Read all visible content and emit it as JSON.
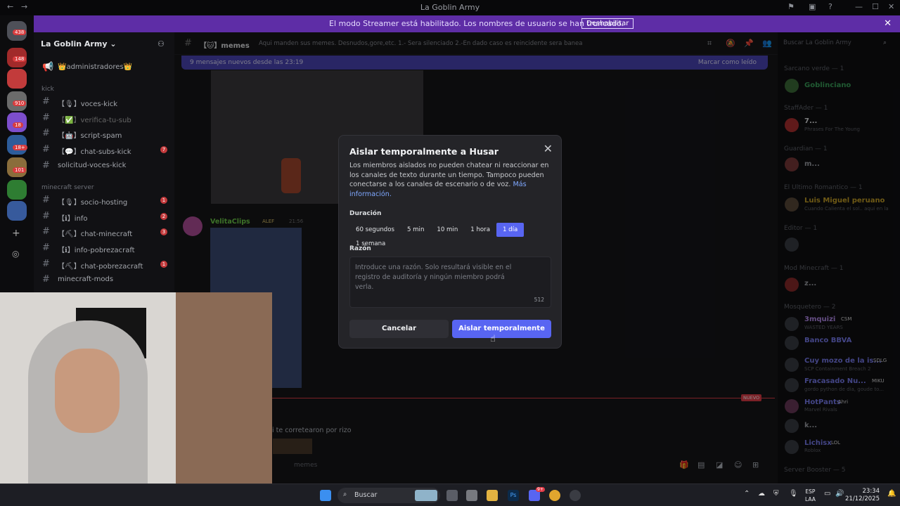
{
  "window": {
    "title": "La Goblin Army"
  },
  "streamer_bar": {
    "message": "El modo Streamer está habilitado. Los nombres de usuario se han truncado.",
    "disable_label": "Deshabilitar"
  },
  "guild_badges": [
    "438",
    "148",
    "910",
    "18",
    "18+",
    "101"
  ],
  "sidebar": {
    "server_name": "La Goblin Army",
    "top_channel": "👑administradores👑",
    "categories": [
      {
        "name": "kick",
        "channels": [
          {
            "label": "【🎙】voces-kick",
            "badge": ""
          },
          {
            "label": "【✅】verifica-tu-sub",
            "badge": ""
          },
          {
            "label": "【🤖】script-spam",
            "badge": ""
          },
          {
            "label": "【💬】chat-subs-kick",
            "badge": "7"
          },
          {
            "label": "solicitud-voces-kick",
            "badge": ""
          }
        ]
      },
      {
        "name": "minecraft server",
        "channels": [
          {
            "label": "【🎙】socio-hosting",
            "badge": "1"
          },
          {
            "label": "【ℹ】info",
            "badge": "2"
          },
          {
            "label": "【⛏】chat-minecraft",
            "badge": "3"
          },
          {
            "label": "【ℹ】info-pobrezacraft",
            "badge": ""
          },
          {
            "label": "【⛏】chat-pobrezacraft",
            "badge": "1"
          },
          {
            "label": "minecraft-mods",
            "badge": ""
          }
        ]
      }
    ]
  },
  "channel_header": {
    "name": "【🐱】memes",
    "topic": "Aqui manden sus memes. Desnudos,gore,etc. 1.- Sera silenciado 2.-En dado caso es reincidente sera baneado"
  },
  "new_messages": {
    "text": "9 mensajes nuevos desde las 23:19",
    "mark_read": "Marcar como leído"
  },
  "chat": {
    "author": "VelitaClips",
    "tag": "ALEF",
    "time": "21:56",
    "new_label": "NUEVO",
    "snippet": "si te corretearon por rizo",
    "input_placeholder": "memes"
  },
  "members_search": {
    "placeholder": "Buscar La Goblin Army"
  },
  "members": [
    {
      "category": "Sarcano verde — 1",
      "name": "Goblinciano",
      "sub": "",
      "color": "#3ba55c"
    },
    {
      "category": "StaffAder — 1",
      "name": "7...",
      "sub": "Phrases For The Young",
      "color": "#e3e5e8"
    },
    {
      "category": "Guardian — 1",
      "name": "m...",
      "sub": "",
      "color": "#9ea1a8"
    },
    {
      "category": "El Ultimo Romantico — 1",
      "name": "Luis Miguel peruano",
      "sub": "Cuando Calienta el sol.. aqui en la",
      "color": "#c9a227"
    },
    {
      "category": "Editor — 1",
      "name": "",
      "sub": "",
      "color": "#9ea1a8"
    },
    {
      "category": "Mod Minecraft — 1",
      "name": "z...",
      "sub": "",
      "color": "#9ea1a8"
    },
    {
      "category": "Mosquetero — 2",
      "name": "3mquizi",
      "sub": "WASTED YEARS",
      "color": "#b98ef0"
    },
    {
      "category": "",
      "name": "Banco BBVA",
      "sub": "",
      "color": "#7b7ff5"
    },
    {
      "category": "",
      "name": "Cuy mozo de la is...",
      "sub": "SCP Containment Breach 2",
      "color": "#7b7ff5"
    },
    {
      "category": "",
      "name": "Fracasado Nu...",
      "sub": "gordo python de día, goude to...",
      "color": "#7b7ff5"
    },
    {
      "category": "",
      "name": "HotPants",
      "sub": "Marvel Rivals",
      "color": "#7b7ff5"
    },
    {
      "category": "",
      "name": "k...",
      "sub": "",
      "color": "#9ea1a8"
    },
    {
      "category": "",
      "name": "Lichisx",
      "sub": "Roblox",
      "color": "#7b7ff5"
    },
    {
      "category": "Server Booster — 5",
      "name": "",
      "sub": "",
      "color": "#9ea1a8"
    }
  ],
  "member_tags": {
    "t1": "CSM",
    "t2": "SDLG",
    "t3": "MIKU",
    "t4": "Ahri",
    "t5": "LOL"
  },
  "modal": {
    "title": "Aislar temporalmente a Husar",
    "description": "Los miembros aislados no pueden chatear ni reaccionar en los canales de texto durante un tiempo. Tampoco pueden conectarse a los canales de escenario o de voz.",
    "more_info": "Más información.",
    "duration_label": "Duración",
    "durations": [
      "60 segundos",
      "5 min",
      "10 min",
      "1 hora",
      "1 día",
      "1 semana"
    ],
    "selected_duration": "1 día",
    "reason_label": "Razón",
    "reason_placeholder": "Introduce una razón. Solo resultará visible en el registro de auditoría y ningún miembro podrá verla.",
    "char_count": "512",
    "cancel": "Cancelar",
    "confirm": "Aislar temporalmente"
  },
  "taskbar": {
    "search": "Buscar",
    "lang1": "ESP",
    "lang2": "LAA",
    "time": "23:34",
    "date": "21/12/2025",
    "badge": "9+"
  },
  "colors": {
    "accent": "#5865f2",
    "streamer": "#5e2da6"
  }
}
